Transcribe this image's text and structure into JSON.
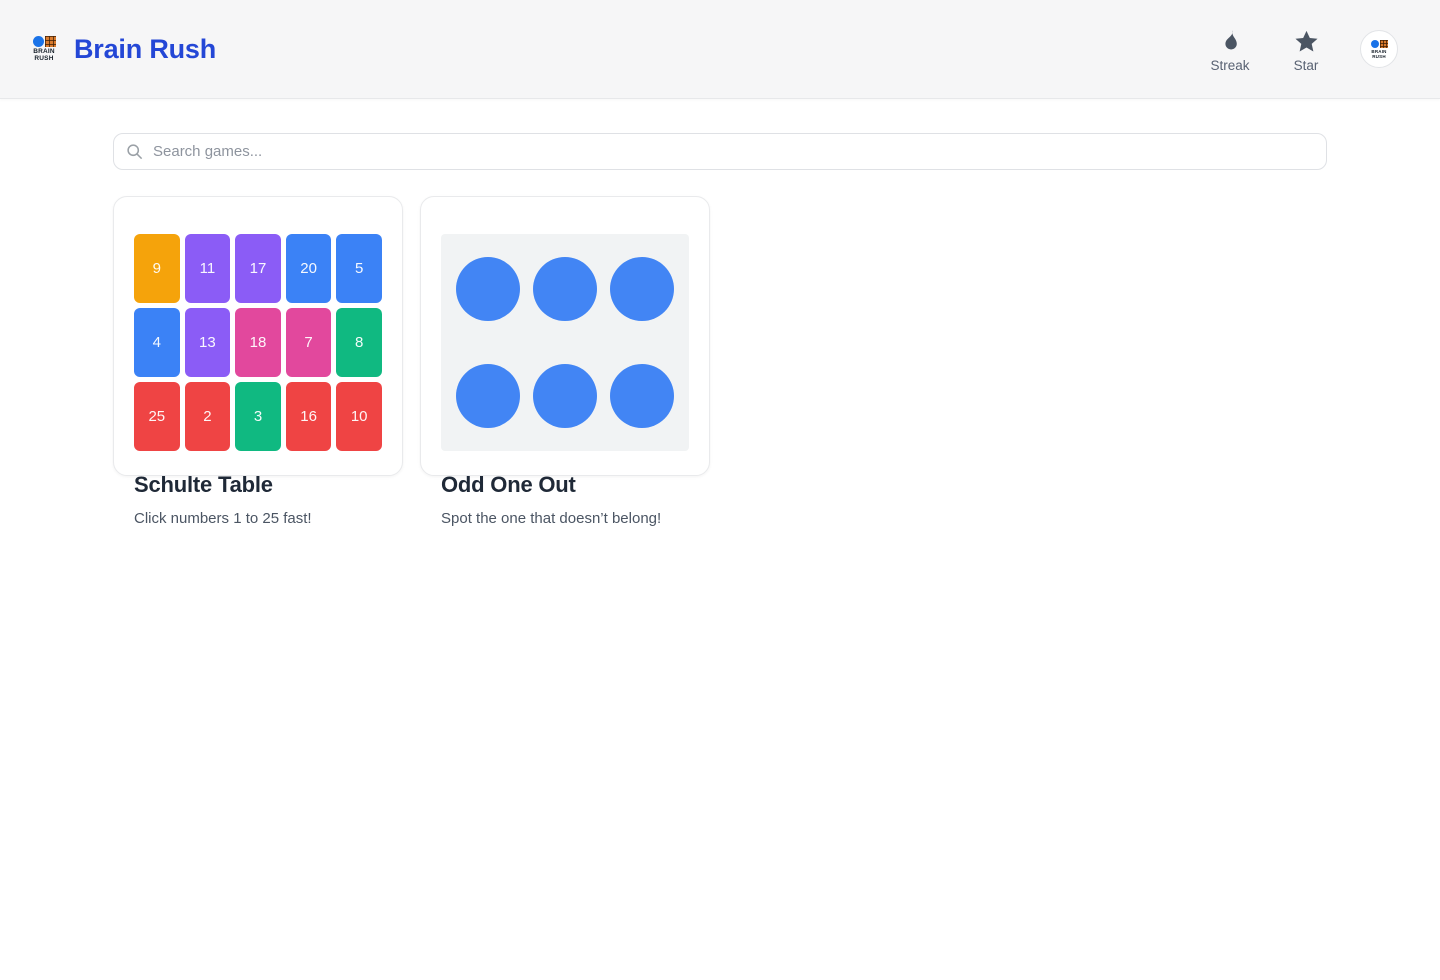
{
  "header": {
    "app_title": "Brain Rush",
    "logo": {
      "line1": "BRAIN",
      "line2": "RUSH"
    },
    "actions": [
      {
        "id": "streak",
        "label": "Streak"
      },
      {
        "id": "star",
        "label": "Star"
      }
    ]
  },
  "search": {
    "placeholder": "Search games..."
  },
  "games": [
    {
      "id": "schulte-table",
      "title": "Schulte Table",
      "subtitle": "Click numbers 1 to 25 fast!",
      "grid": {
        "columns": 5,
        "rows": 3,
        "tiles": [
          {
            "n": "9",
            "color": "#F5A30B"
          },
          {
            "n": "11",
            "color": "#8B5CF6"
          },
          {
            "n": "17",
            "color": "#8B5CF6"
          },
          {
            "n": "20",
            "color": "#3B82F6"
          },
          {
            "n": "5",
            "color": "#3B82F6"
          },
          {
            "n": "4",
            "color": "#3B82F6"
          },
          {
            "n": "13",
            "color": "#8B5CF6"
          },
          {
            "n": "18",
            "color": "#E2489D"
          },
          {
            "n": "7",
            "color": "#E2489D"
          },
          {
            "n": "8",
            "color": "#10B981"
          },
          {
            "n": "25",
            "color": "#EF4444"
          },
          {
            "n": "2",
            "color": "#EF4444"
          },
          {
            "n": "3",
            "color": "#10B981"
          },
          {
            "n": "16",
            "color": "#EF4444"
          },
          {
            "n": "10",
            "color": "#EF4444"
          }
        ]
      }
    },
    {
      "id": "odd-one-out",
      "title": "Odd One Out",
      "subtitle": "Spot the one that doesn’t belong!",
      "circles": {
        "count": 6,
        "columns": 3,
        "color": "#4285F4",
        "panel_bg": "#F1F3F4"
      }
    }
  ],
  "colors": {
    "brand_blue": "#2447D6",
    "header_bg": "#F6F6F7",
    "icon_slate": "#4B5563"
  }
}
